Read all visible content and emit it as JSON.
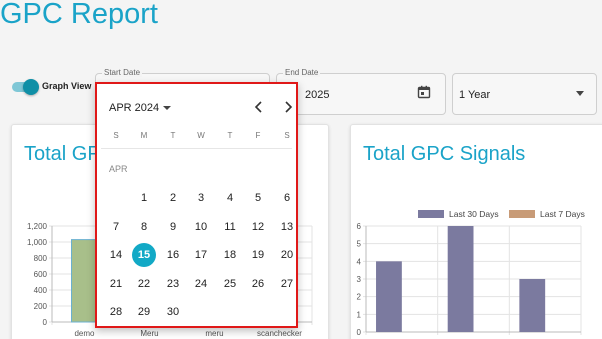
{
  "page": {
    "title": "GPC Report"
  },
  "toggle": {
    "label": "Graph View",
    "on": true
  },
  "start_field": {
    "label": "Start Date"
  },
  "end_field": {
    "label": "End Date",
    "value": "2025"
  },
  "range_select": {
    "value": "1 Year"
  },
  "calendar": {
    "month_header": "APR 2024",
    "weekdays": [
      "S",
      "M",
      "T",
      "W",
      "T",
      "F",
      "S"
    ],
    "month_label": "APR",
    "selected_day": "15",
    "weeks": [
      [
        "",
        "1",
        "2",
        "3",
        "4",
        "5",
        "6"
      ],
      [
        "7",
        "8",
        "9",
        "10",
        "11",
        "12",
        "13"
      ],
      [
        "14",
        "15",
        "16",
        "17",
        "18",
        "19",
        "20"
      ],
      [
        "21",
        "22",
        "23",
        "24",
        "25",
        "26",
        "27"
      ],
      [
        "28",
        "29",
        "30",
        "",
        "",
        "",
        ""
      ]
    ]
  },
  "card_left": {
    "title": "Total GPC Signals"
  },
  "card_right": {
    "title": "Total GPC Signals"
  },
  "chart_data": [
    {
      "type": "bar",
      "title": "Total GPC Signals",
      "categories": [
        "demo",
        "Meru",
        "meru",
        "scanchecker"
      ],
      "series": [
        {
          "values": [
            1030,
            0,
            0,
            0
          ]
        }
      ],
      "yticks": [
        "0",
        "200",
        "400",
        "600",
        "800",
        "1,000",
        "1,200"
      ],
      "ylim": [
        0,
        1200
      ],
      "colors": [
        "#a8bf8a"
      ]
    },
    {
      "type": "bar",
      "title": "Total GPC Signals",
      "categories": [
        "",
        "",
        ""
      ],
      "series": [
        {
          "name": "Last 30 Days",
          "values": [
            4,
            6,
            3
          ]
        },
        {
          "name": "Last 7 Days",
          "values": [
            0,
            0,
            0
          ]
        }
      ],
      "yticks": [
        "0",
        "1",
        "2",
        "3",
        "4",
        "5",
        "6"
      ],
      "ylim": [
        0,
        6
      ],
      "colors": [
        "#7b7a9f",
        "#c89b77"
      ],
      "legend": "top"
    }
  ]
}
